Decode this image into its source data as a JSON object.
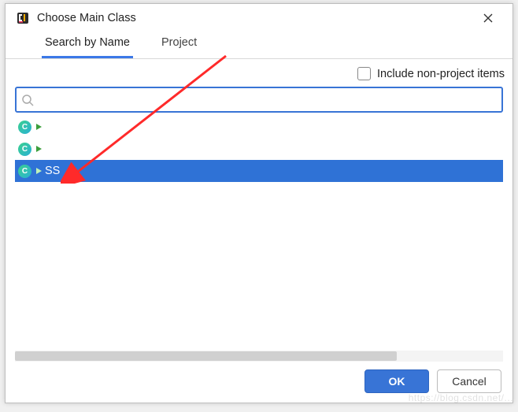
{
  "titlebar": {
    "title": "Choose Main Class"
  },
  "tabs": {
    "search": "Search by Name",
    "project": "Project"
  },
  "options": {
    "include_nonproject": "Include non-project items",
    "include_checked": false
  },
  "search": {
    "value": "",
    "placeholder": ""
  },
  "results": {
    "items": [
      {
        "label": "",
        "selected": false
      },
      {
        "label": "",
        "selected": false
      },
      {
        "label": "SS",
        "selected": true
      }
    ]
  },
  "buttons": {
    "ok": "OK",
    "cancel": "Cancel"
  },
  "watermark": "https://blog.csdn.net/..."
}
